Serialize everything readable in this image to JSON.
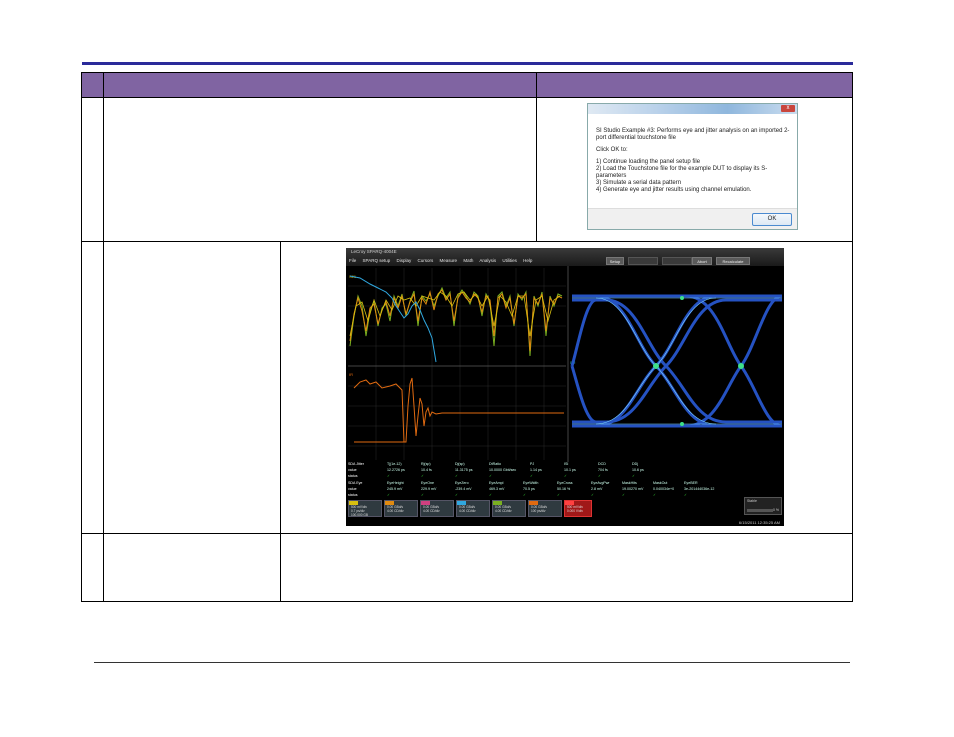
{
  "dialog": {
    "close_label": "x",
    "line1": "SI Studio Example #3: Performs eye and jitter analysis on an imported 2-port differential touchstone file",
    "line2": "Click OK to:",
    "steps": [
      "1) Continue loading the panel setup file",
      "2) Load the Touchstone file for the example DUT to display its S-parameters",
      "3) Simulate a serial data pattern",
      "4) Generate eye and jitter results using channel emulation."
    ],
    "ok_label": "OK"
  },
  "scope": {
    "title": "LeCroy SPARQ-4004E",
    "menus": [
      "File",
      "SPARQ setup",
      "Display",
      "Cursors",
      "Measure",
      "Math",
      "Analysis",
      "Utilities",
      "Help"
    ],
    "buttons": [
      "Setup",
      "Abort",
      "Recalculate"
    ],
    "waveform_labels": {
      "s21": "S21",
      "impulse": "IR",
      "eye": "ER"
    },
    "meas_rows": [
      {
        "name": "SDA Jitter",
        "items": [
          "Tj(1e-12)",
          "Rj(sp)",
          "Dj(sp)",
          "DtRatio",
          "PJ",
          "ISI",
          "DCD",
          "DDj"
        ]
      },
      {
        "name": "value",
        "items": [
          "12.2726 ps",
          "10.4 fs",
          "11.3175 ps",
          "10.0000 Gbit/sec",
          "1.14 ps",
          "10.1 ps",
          "704 fs",
          "10.6 ps"
        ]
      },
      {
        "name": "status",
        "items": [
          "✓",
          "✓",
          "✓",
          "✓",
          "✓",
          "✓",
          "✓",
          "✓"
        ]
      },
      {
        "name": "SDA Eye",
        "items": [
          "EyeHeight",
          "EyeOne",
          "EyeZero",
          "EyeAmpl",
          "EyeWidth",
          "EyeCross",
          "EyeAvgPwr",
          "MaskHits",
          "MaskOut",
          "EyeBER"
        ]
      },
      {
        "name": "value",
        "items": [
          "245.9 mV",
          "229.9 mV",
          "-239.4 mV",
          "469.3 mV",
          "70.5 ps",
          "50.16 %",
          "2.8 mV",
          "19.00270 mV",
          "0.040034e+0",
          "3e-201444036e-12"
        ]
      },
      {
        "name": "status",
        "items": [
          "✓",
          "✓",
          "✓",
          "✓",
          "✓",
          "✓",
          "✓",
          "✓",
          "✓",
          "✓"
        ]
      }
    ],
    "chips": [
      {
        "tag": "S21",
        "l1": "500 mV/div",
        "l2": "0.7 ps/div",
        "l3": "100.000 GB"
      },
      {
        "tag": "IR",
        "l1": "0.00 GBd/s",
        "l2": "4.00 CD/div"
      },
      {
        "tag": "ER",
        "l1": "0.00 GBd/s",
        "l2": "4.00 CD/div"
      },
      {
        "tag": "EW",
        "l1": "0.00 GBd/s",
        "l2": "4.00 CD/div"
      },
      {
        "tag": "DE",
        "l1": "0.00 GBd/s",
        "l2": "4.00 CD/div"
      },
      {
        "tag": "SR",
        "l1": "0.00 GBd/s",
        "l2": "100 ps/div"
      },
      {
        "tag": "M1",
        "l1": "500 mV/div",
        "l2": "0.000 V/div"
      }
    ],
    "progress_label": "Stable",
    "progress_value": "0 %",
    "timestamp": "6/15/2011 12:35:25 AM"
  },
  "colors": {
    "header": "#8064a2",
    "rule": "#2a2a9a",
    "s21_yellow": "#d8c010",
    "s21_orange": "#e08a10",
    "s21_green": "#7ab020",
    "s11_cyan": "#30a8e0",
    "impulse": "#e06a10",
    "eye": "#2a5bd8"
  }
}
